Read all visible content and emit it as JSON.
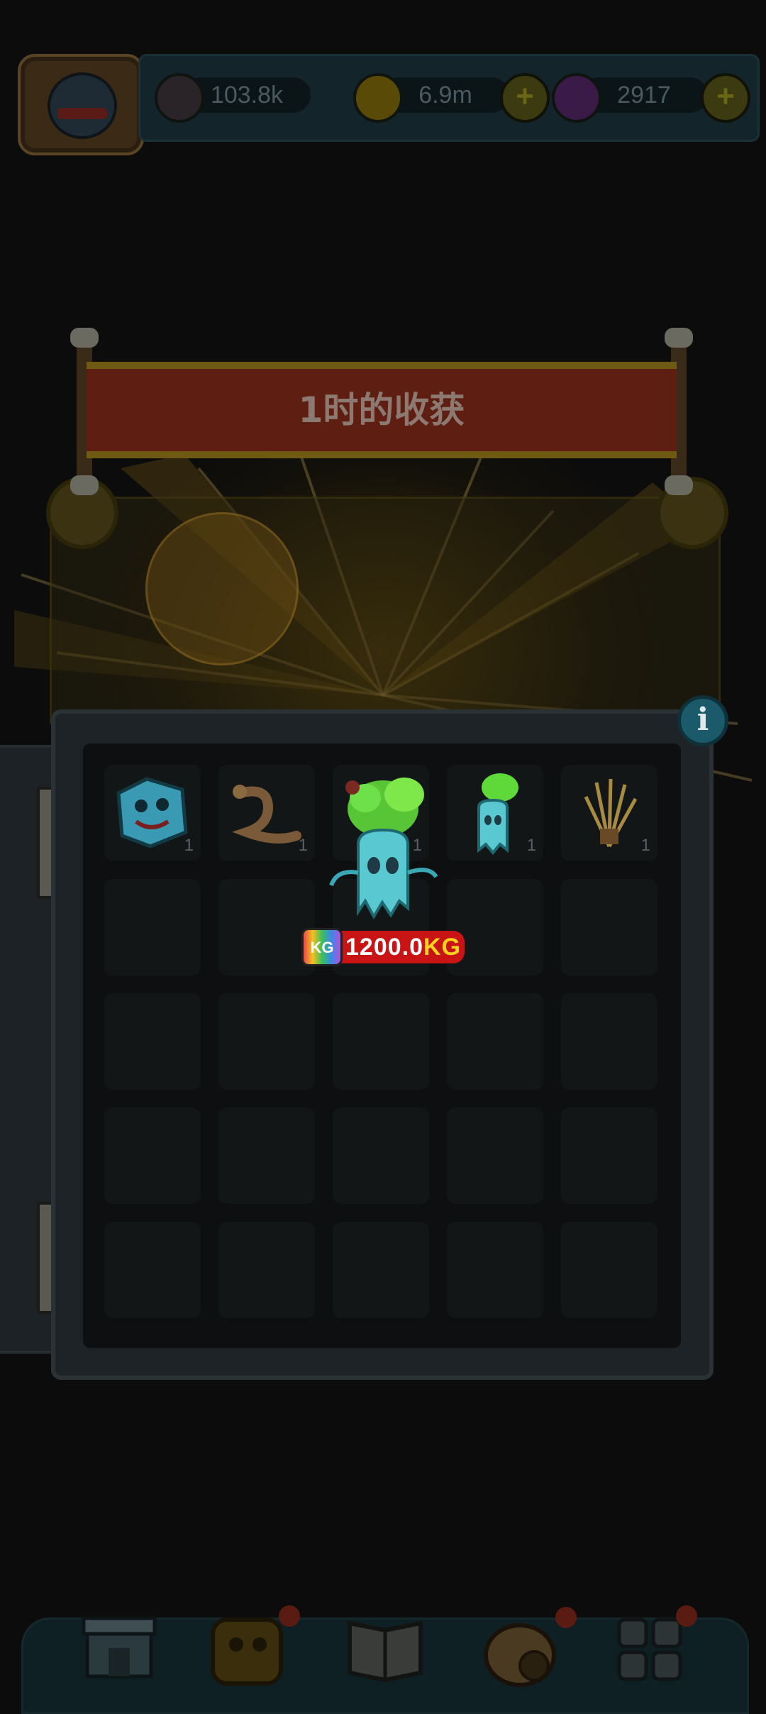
{
  "topbar": {
    "resources": [
      {
        "name": "eye-resource",
        "value": "103.8k",
        "icon": "eyeball-icon",
        "color": "#2a2428",
        "has_plus": false
      },
      {
        "name": "coin-resource",
        "value": "6.9m",
        "icon": "coin-icon",
        "color": "#5a4a08",
        "has_plus": true
      },
      {
        "name": "potion-resource",
        "value": "2917",
        "icon": "potion-icon",
        "color": "#3a1a46",
        "has_plus": true
      }
    ],
    "plus_label": "+"
  },
  "banner": {
    "title": "1时的收获"
  },
  "info_label": "i",
  "grid": {
    "rows": 5,
    "cols": 5,
    "items": [
      {
        "name": "blue-creature-item",
        "count": "1",
        "icon": "blue-creature-icon"
      },
      {
        "name": "worm-item",
        "count": "1",
        "icon": "worm-icon"
      },
      {
        "name": "ghost-radish-item",
        "count": "1",
        "icon": "ghost-radish-icon"
      },
      {
        "name": "small-ghost-item",
        "count": "1",
        "icon": "small-ghost-icon"
      },
      {
        "name": "wheat-bundle-item",
        "count": "1",
        "icon": "wheat-bundle-icon"
      }
    ]
  },
  "highlight": {
    "item_icon": "ghost-radish-icon",
    "weight_badge": "KG",
    "weight_value": "1200.0",
    "weight_unit": "KG"
  },
  "bottom_nav": [
    {
      "name": "nav-shop",
      "icon": "shop-icon"
    },
    {
      "name": "nav-monster",
      "icon": "monster-icon"
    },
    {
      "name": "nav-book",
      "icon": "book-icon"
    },
    {
      "name": "nav-bag",
      "icon": "bag-icon"
    },
    {
      "name": "nav-grid",
      "icon": "grid-icon"
    }
  ]
}
